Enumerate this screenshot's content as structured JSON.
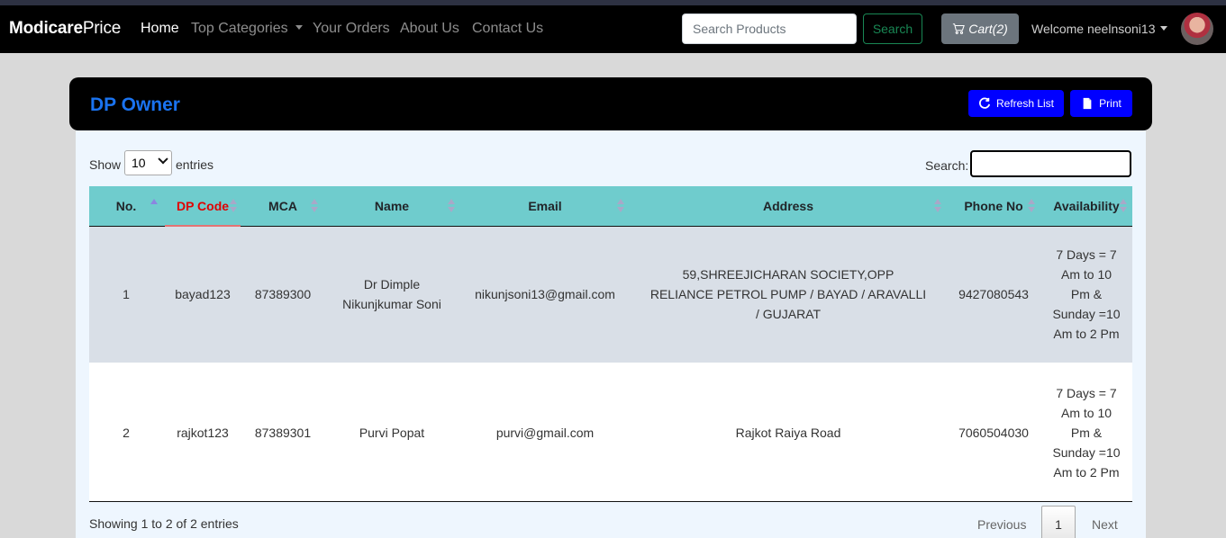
{
  "navbar": {
    "brand_bold": "Modicare",
    "brand_rest": "Price",
    "links": [
      {
        "label": "Home"
      },
      {
        "label": "Top Categories"
      },
      {
        "label": "Your Orders"
      },
      {
        "label": "About Us"
      },
      {
        "label": "Contact Us"
      }
    ],
    "search_placeholder": "Search Products",
    "search_button": "Search",
    "cart_label": "Cart(2)",
    "welcome": "Welcome neelnsoni13"
  },
  "card": {
    "title": "DP Owner",
    "refresh_label": "Refresh List",
    "print_label": "Print"
  },
  "table_controls": {
    "show_label": "Show",
    "entries_value": "10",
    "entries_label": "entries",
    "search_label": "Search:"
  },
  "table": {
    "columns": [
      "No.",
      "DP Code",
      "MCA",
      "Name",
      "Email",
      "Address",
      "Phone No",
      "Availability"
    ],
    "rows": [
      {
        "no": "1",
        "dp_code": "bayad123",
        "mca": "87389300",
        "name": "Dr Dimple Nikunjkumar Soni",
        "email": "nikunjsoni13@gmail.com",
        "address": "59,SHREEJICHARAN SOCIETY,OPP RELIANCE PETROL PUMP / BAYAD / ARAVALLI / GUJARAT",
        "phone": "9427080543",
        "availability": "7 Days = 7 Am to 10 Pm & Sunday =10 Am to 2 Pm"
      },
      {
        "no": "2",
        "dp_code": "rajkot123",
        "mca": "87389301",
        "name": "Purvi Popat",
        "email": "purvi@gmail.com",
        "address": "Rajkot Raiya Road",
        "phone": "7060504030",
        "availability": "7 Days = 7 Am to 10 Pm & Sunday =10 Am to 2 Pm"
      }
    ]
  },
  "footer": {
    "info": "Showing 1 to 2 of 2 entries",
    "previous": "Previous",
    "page": "1",
    "next": "Next"
  }
}
